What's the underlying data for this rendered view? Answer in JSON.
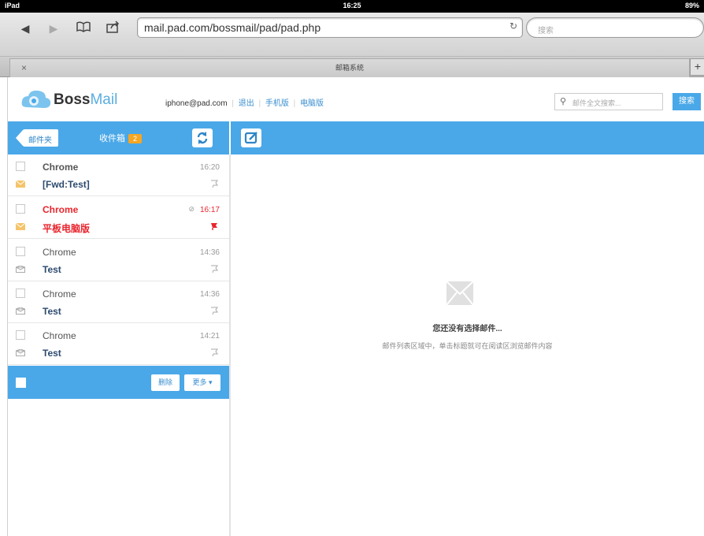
{
  "status_bar": {
    "device": "iPad",
    "time": "16:25",
    "battery": "89%"
  },
  "browser": {
    "url": "mail.pad.com/bossmail/pad/pad.php",
    "search_placeholder": "搜索",
    "tab_title": "邮箱系统"
  },
  "app": {
    "logo": {
      "part1": "Boss",
      "part2": "Mail"
    },
    "account_email": "iphone@pad.com",
    "links": [
      "退出",
      "手机版",
      "电脑版"
    ],
    "search_placeholder": "邮件全文搜索...",
    "search_button": "搜索"
  },
  "toolbar": {
    "back_label": "邮件夹",
    "inbox_label": "收件箱",
    "unread_count": "2"
  },
  "messages": [
    {
      "sender": "Chrome",
      "subject": "[Fwd:Test]",
      "time": "16:20",
      "unread": true,
      "flagged": false,
      "attachment": false
    },
    {
      "sender": "Chrome",
      "subject": "平板电脑版",
      "time": "16:17",
      "unread": true,
      "flagged": true,
      "attachment": true
    },
    {
      "sender": "Chrome",
      "subject": "Test",
      "time": "14:36",
      "unread": false,
      "flagged": false,
      "attachment": false
    },
    {
      "sender": "Chrome",
      "subject": "Test",
      "time": "14:36",
      "unread": false,
      "flagged": false,
      "attachment": false
    },
    {
      "sender": "Chrome",
      "subject": "Test",
      "time": "14:21",
      "unread": false,
      "flagged": false,
      "attachment": false
    }
  ],
  "list_actions": {
    "delete": "删除",
    "more": "更多"
  },
  "empty_state": {
    "title": "您还没有选择邮件...",
    "subtitle": "邮件列表区域中，单击标题就可在阅读区浏览邮件内容"
  },
  "colors": {
    "accent": "#4aa8e8",
    "flag_red": "#e8262e",
    "badge": "#f5a623"
  }
}
